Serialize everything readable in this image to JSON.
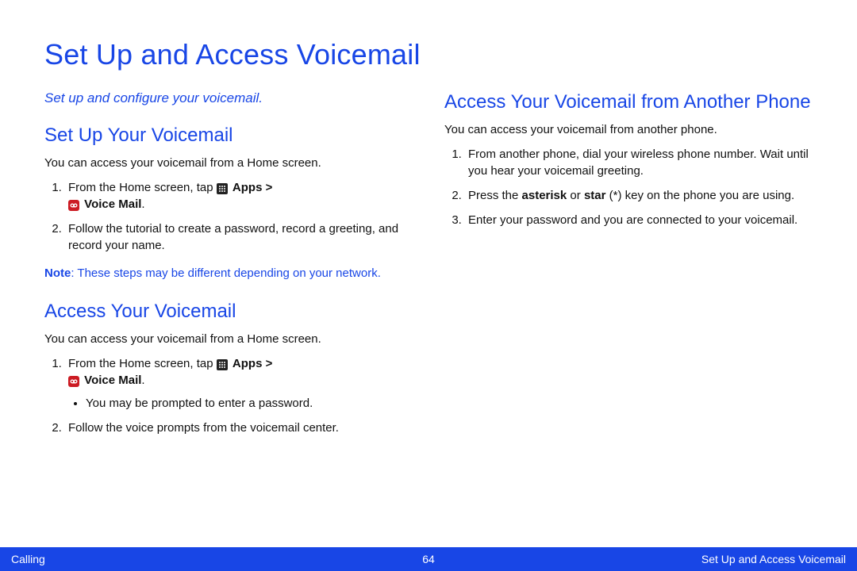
{
  "title": "Set Up and Access Voicemail",
  "subtitle": "Set up and configure your voicemail.",
  "left": {
    "section1": {
      "heading": "Set Up Your Voicemail",
      "intro": "You can access your voicemail from a Home screen.",
      "step1_pre": "From the Home screen, tap ",
      "apps_label": "Apps",
      "gt": " > ",
      "vm_label": "Voice Mail",
      "step1_post": ".",
      "step2": "Follow the tutorial to create a password, record a greeting, and record your name.",
      "note_label": "Note",
      "note_text": ": These steps may be different depending on your network."
    },
    "section2": {
      "heading": "Access Your Voicemail",
      "intro": "You can access your voicemail from a Home screen.",
      "step1_pre": "From the Home screen, tap ",
      "apps_label": "Apps",
      "gt": " > ",
      "vm_label": "Voice Mail",
      "step1_post": ".",
      "bullet1": "You may be prompted to enter a password.",
      "step2": "Follow the voice prompts from the voicemail center."
    }
  },
  "right": {
    "section": {
      "heading": "Access Your Voicemail from Another Phone",
      "intro": "You can access your voicemail from another phone.",
      "step1": "From another phone, dial your wireless phone number. Wait until you hear your voicemail greeting.",
      "step2_pre": "Press the ",
      "asterisk": "asterisk",
      "or": " or ",
      "star": "star",
      "paren": " (*) ",
      "step2_post": "key on the phone you are using.",
      "step3": "Enter your password and you are connected to your voicemail."
    }
  },
  "footer": {
    "left": "Calling",
    "center": "64",
    "right": "Set Up and Access Voicemail"
  }
}
